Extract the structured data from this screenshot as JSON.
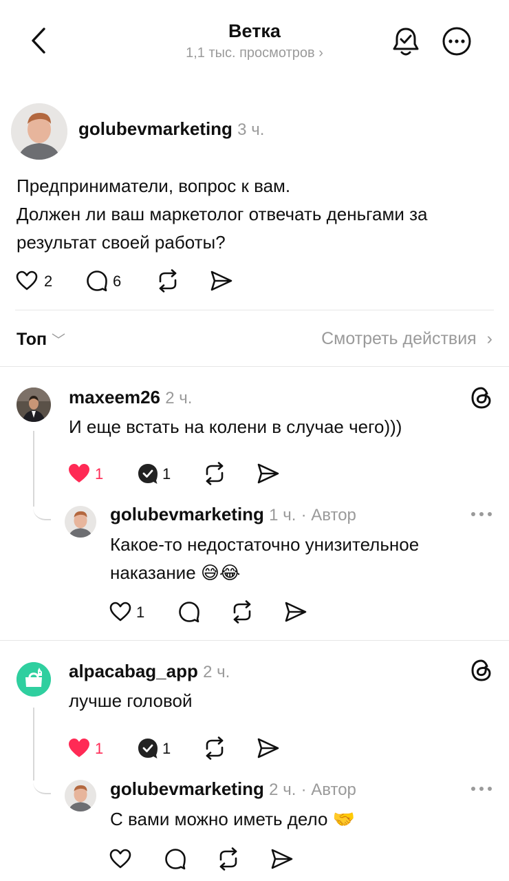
{
  "header": {
    "title": "Ветка",
    "views": "1,1 тыс. просмотров",
    "back_icon": "chevron-left-icon",
    "bell_icon": "bell-check-icon",
    "more_icon": "more-circle-icon"
  },
  "post": {
    "username": "golubevmarketing",
    "time": "3 ч.",
    "text_lines": [
      "Предприниматели, вопрос к вам.",
      "Должен ли ваш маркетолог отвечать деньгами за",
      "результат своей работы?"
    ],
    "likes": "2",
    "replies": "6"
  },
  "filter": {
    "sort_label": "Топ",
    "activity_link": "Смотреть действия"
  },
  "comments": [
    {
      "username": "maxeem26",
      "time": "2 ч.",
      "text": "И еще встать на колени в случае чего)))",
      "likes": "1",
      "replies": "1",
      "liked": true,
      "reply": {
        "username": "golubevmarketing",
        "time": "1 ч.",
        "badge": "· Автор",
        "text_lines": [
          "Какое-то недостаточно унизительное",
          "наказание"
        ],
        "emoji": "😅😂",
        "likes": "1"
      }
    },
    {
      "username": "alpacabag_app",
      "time": "2 ч.",
      "text": "лучше головой",
      "likes": "1",
      "replies": "1",
      "liked": true,
      "reply": {
        "username": "golubevmarketing",
        "time": "2 ч.",
        "badge": "· Автор",
        "text": "С вами можно иметь дело",
        "emoji": "🤝"
      }
    }
  ],
  "colors": {
    "like_red": "#ff2a55",
    "accent_green": "#2fcf9f",
    "divider": "#e6e6e6"
  }
}
